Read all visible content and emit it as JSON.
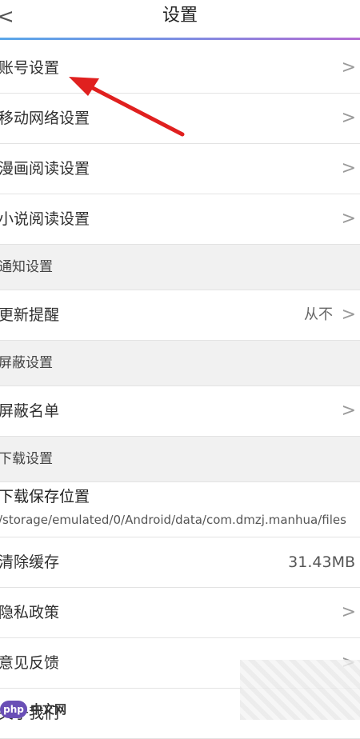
{
  "header": {
    "title": "设置",
    "back_glyph": "<"
  },
  "rows": {
    "account": {
      "label": "账号设置",
      "chevron": ">"
    },
    "mobile_network": {
      "label": "移动网络设置",
      "chevron": ">"
    },
    "comic_reading": {
      "label": "漫画阅读设置",
      "chevron": ">"
    },
    "novel_reading": {
      "label": "小说阅读设置",
      "chevron": ">"
    },
    "update_reminder": {
      "label": "更新提醒",
      "value": "从不",
      "chevron": ">"
    },
    "block_list": {
      "label": "屏蔽名单",
      "chevron": ">"
    },
    "download_location": {
      "label": "下载保存位置",
      "path": "/storage/emulated/0/Android/data/com.dmzj.manhua/files"
    },
    "clear_cache": {
      "label": "清除缓存",
      "value": "31.43MB"
    },
    "privacy_policy": {
      "label": "隐私政策",
      "chevron": ">"
    },
    "feedback": {
      "label": "意见反馈",
      "chevron": ">"
    },
    "partial_last": {
      "label": "关于我们"
    }
  },
  "sections": {
    "notifications": "通知设置",
    "blocking": "屏蔽设置",
    "downloads": "下载设置"
  },
  "annotation": {
    "icon": "red-arrow",
    "color": "#e0201f"
  },
  "watermark": {
    "badge": "php",
    "text": "中文网"
  }
}
